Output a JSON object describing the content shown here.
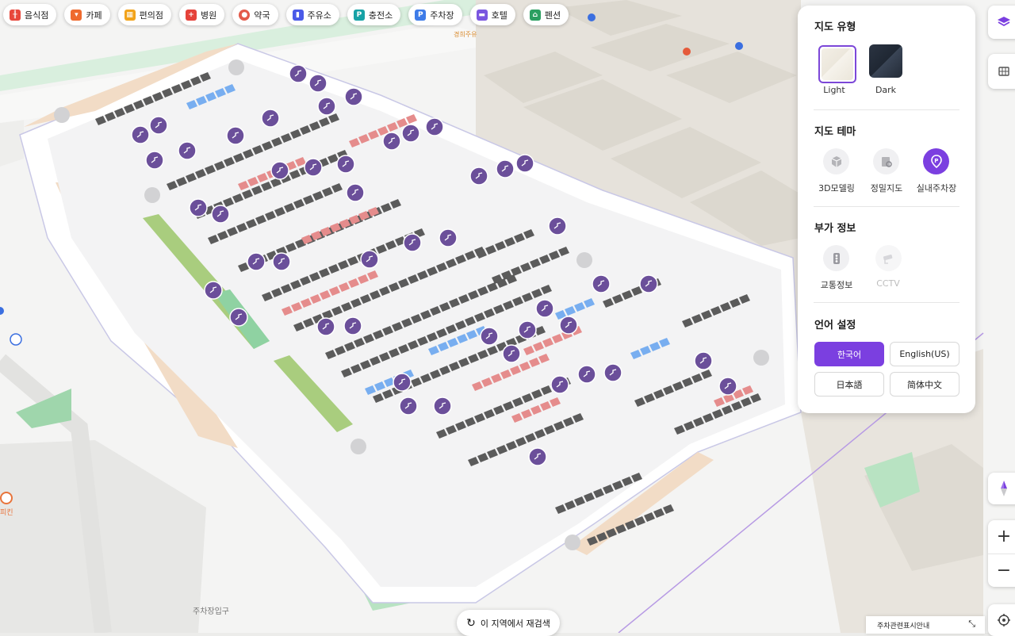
{
  "categories": [
    {
      "label": "음식점",
      "icon": "fork-knife-icon",
      "color": "#e8473b"
    },
    {
      "label": "카페",
      "icon": "coffee-cup-icon",
      "color": "#ef6a2e"
    },
    {
      "label": "편의점",
      "icon": "store-icon",
      "color": "#f2a31a"
    },
    {
      "label": "병원",
      "icon": "hospital-cross-icon",
      "color": "#e5423a"
    },
    {
      "label": "약국",
      "icon": "pill-icon",
      "color": "#e35a4a"
    },
    {
      "label": "주유소",
      "icon": "fuel-pump-icon",
      "color": "#4a5ae8"
    },
    {
      "label": "충전소",
      "icon": "charging-plug-icon",
      "color": "#17a2a6"
    },
    {
      "label": "주차장",
      "icon": "parking-icon",
      "color": "#3d7be8"
    },
    {
      "label": "호텔",
      "icon": "bed-icon",
      "color": "#7a56e0"
    },
    {
      "label": "펜션",
      "icon": "house-icon",
      "color": "#2b9f61"
    }
  ],
  "panel": {
    "map_type": {
      "title": "지도 유형",
      "options": [
        {
          "label": "Light",
          "selected": true
        },
        {
          "label": "Dark",
          "selected": false
        }
      ]
    },
    "map_theme": {
      "title": "지도 테마",
      "options": [
        {
          "label": "3D모델링",
          "icon": "cube-icon",
          "active": false
        },
        {
          "label": "정밀지도",
          "icon": "precision-map-icon",
          "active": false
        },
        {
          "label": "실내주차장",
          "icon": "indoor-parking-icon",
          "active": true
        }
      ]
    },
    "extra_info": {
      "title": "부가 정보",
      "options": [
        {
          "label": "교통정보",
          "icon": "traffic-light-icon",
          "enabled": true
        },
        {
          "label": "CCTV",
          "icon": "cctv-icon",
          "enabled": false
        }
      ]
    },
    "language": {
      "title": "언어 설정",
      "options": [
        {
          "label": "한국어",
          "active": true
        },
        {
          "label": "English(US)",
          "active": false
        },
        {
          "label": "日本語",
          "active": false
        },
        {
          "label": "简体中文",
          "active": false
        }
      ]
    }
  },
  "map_labels": {
    "parking_entrance": "주차장입구",
    "gas_station": "경희주유",
    "food_poi": "피킨",
    "research_button": "이 지역에서 재검색",
    "notice": "주차관련표시안내"
  },
  "accent_color": "#7b3fe0"
}
